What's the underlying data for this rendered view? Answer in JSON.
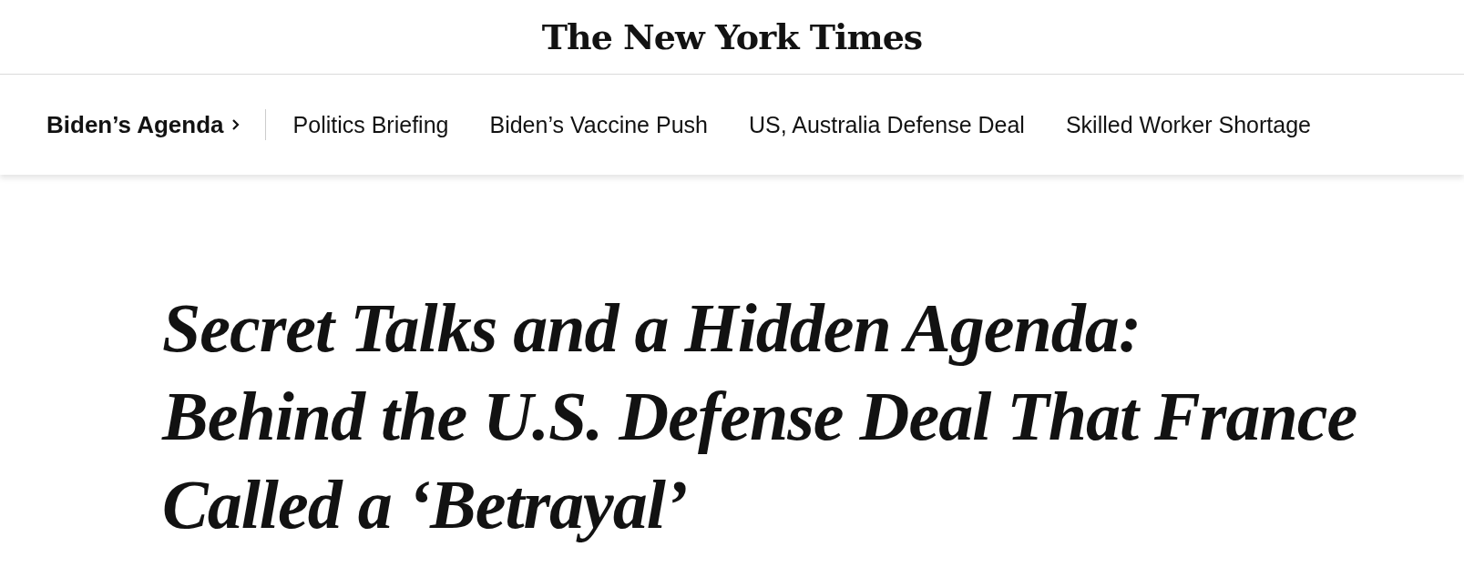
{
  "masthead": {
    "logo": "The New York Times"
  },
  "nav": {
    "section": {
      "label": "Biden’s Agenda"
    },
    "links": [
      "Politics Briefing",
      "Biden’s Vaccine Push",
      "US, Australia Defense Deal",
      "Skilled Worker Shortage"
    ]
  },
  "article": {
    "headline": "Secret Talks and a Hidden Agenda:\nBehind the U.S. Defense Deal That France\nCalled a ‘Betrayal’"
  }
}
